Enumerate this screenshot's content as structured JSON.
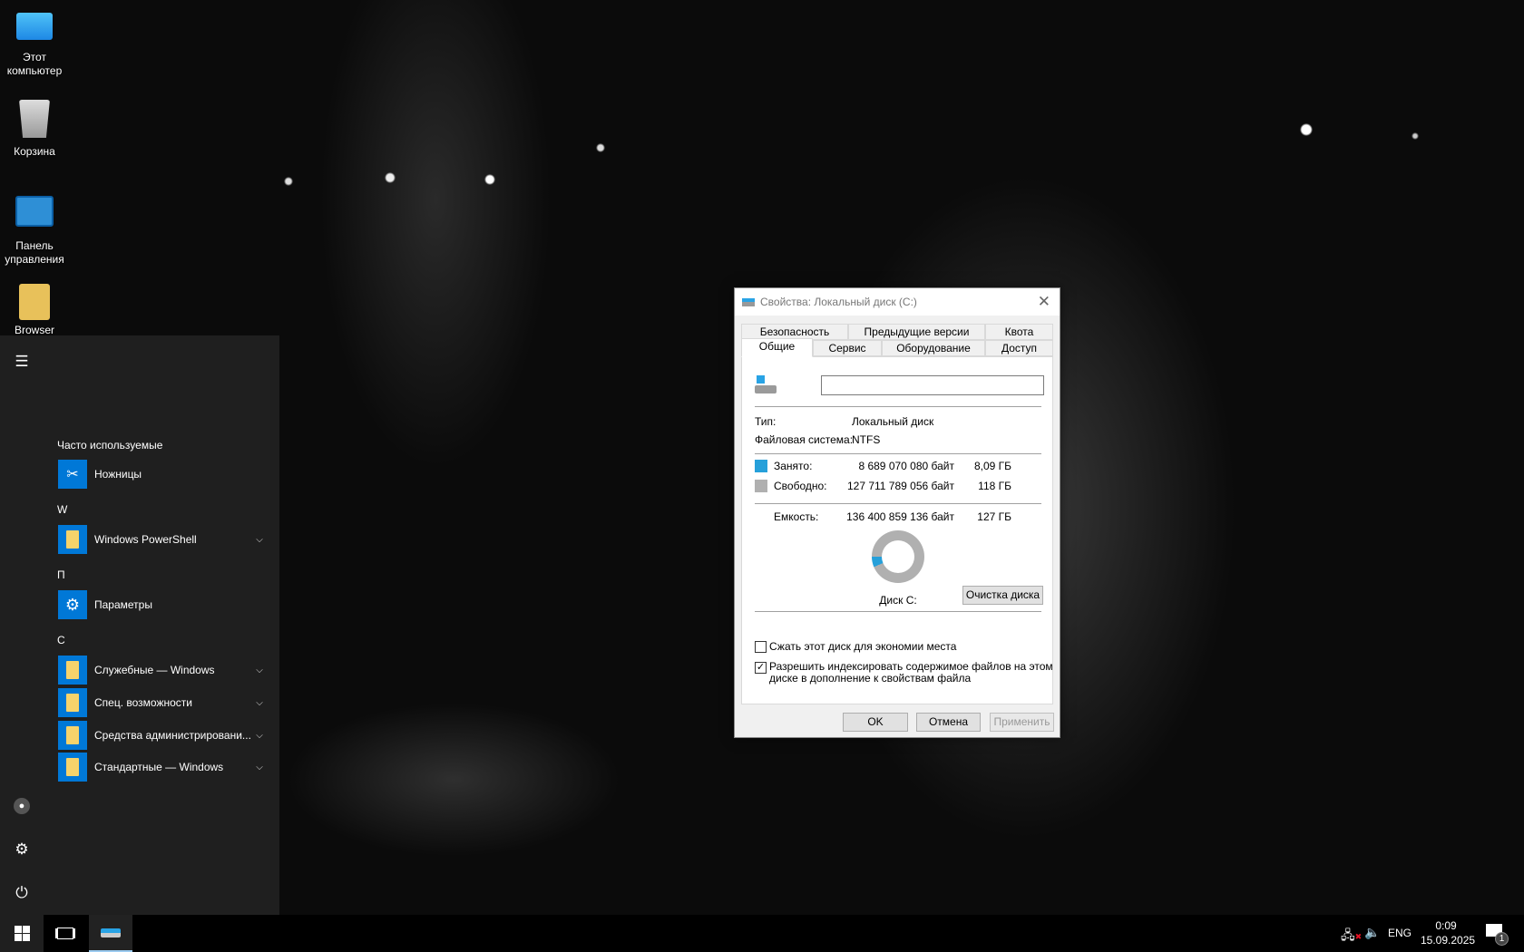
{
  "desktop": {
    "icons": [
      {
        "label": "Этот компьютер",
        "icon": "computer-icon"
      },
      {
        "label": "Корзина",
        "icon": "recycle-bin-icon"
      },
      {
        "label": "Панель управления",
        "icon": "control-panel-icon"
      },
      {
        "label": "Browser",
        "icon": "folder-icon"
      }
    ]
  },
  "start_menu": {
    "groups": [
      {
        "header": "Часто используемые",
        "apps": [
          {
            "label": "Ножницы"
          }
        ]
      },
      {
        "header": "W",
        "apps": [
          {
            "label": "Windows PowerShell"
          }
        ]
      },
      {
        "header": "П",
        "apps": [
          {
            "label": "Параметры"
          }
        ]
      },
      {
        "header": "С",
        "apps": [
          {
            "label": "Служебные — Windows"
          },
          {
            "label": "Спец. возможности"
          },
          {
            "label": "Средства администрировани..."
          },
          {
            "label": "Стандартные — Windows"
          }
        ]
      }
    ]
  },
  "dialog": {
    "title": "Свойства: Локальный диск (C:)",
    "tabs_row1": [
      "Безопасность",
      "Предыдущие версии",
      "Квота"
    ],
    "tabs_row2": [
      "Общие",
      "Сервис",
      "Оборудование",
      "Доступ"
    ],
    "active_tab": "Общие",
    "name_value": "",
    "type_label": "Тип:",
    "type_value": "Локальный диск",
    "fs_label": "Файловая система:",
    "fs_value": "NTFS",
    "used_label": "Занято:",
    "used_bytes": "8 689 070 080 байт",
    "used_gb": "8,09 ГБ",
    "free_label": "Свободно:",
    "free_bytes": "127 711 789 056 байт",
    "free_gb": "118 ГБ",
    "capacity_label": "Емкость:",
    "capacity_bytes": "136 400 859 136 байт",
    "capacity_gb": "127 ГБ",
    "used_fraction": 0.0637,
    "used_color": "#26a0da",
    "free_color": "#b0b0b0",
    "disk_label": "Диск C:",
    "cleanup_button": "Очистка диска",
    "compress_label": "Сжать этот диск для экономии места",
    "compress_checked": false,
    "index_label_1": "Разрешить индексировать содержимое файлов на этом",
    "index_label_2": "диске в дополнение к свойствам файла",
    "index_checked": true,
    "ok": "OK",
    "cancel": "Отмена",
    "apply": "Применить"
  },
  "taskbar": {
    "language": "ENG",
    "time": "0:09",
    "date": "15.09.2025",
    "notifications_count": "1"
  }
}
